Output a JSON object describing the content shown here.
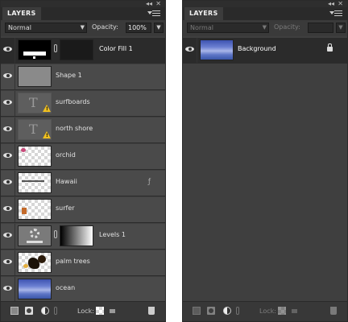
{
  "left_panel": {
    "tab_label": "LAYERS",
    "blend_mode": "Normal",
    "opacity_label": "Opacity:",
    "opacity_value": "100%",
    "layers": [
      {
        "name": "Color Fill 1",
        "thumb": "fill-thumb"
      },
      {
        "name": "Shape 1",
        "thumb": "shape-thumb"
      },
      {
        "name": "surfboards",
        "thumb": "text-thumb"
      },
      {
        "name": "north shore",
        "thumb": "text-thumb"
      },
      {
        "name": "orchid",
        "thumb": "transparent-thumb"
      },
      {
        "name": "Hawaii",
        "thumb": "transparent-thumb"
      },
      {
        "name": "surfer",
        "thumb": "transparent-thumb"
      },
      {
        "name": "Levels 1",
        "thumb": "adjustment-thumb"
      },
      {
        "name": "palm trees",
        "thumb": "photo-thumb"
      },
      {
        "name": "ocean",
        "thumb": "photo-thumb"
      }
    ],
    "lock_label": "Lock:"
  },
  "right_panel": {
    "tab_label": "LAYERS",
    "blend_mode": "Normal",
    "opacity_label": "Opacity:",
    "opacity_value": "",
    "layers": [
      {
        "name": "Background",
        "thumb": "photo-thumb"
      }
    ],
    "lock_label": "Lock:"
  },
  "icons": {
    "eye": "eye-icon",
    "warning": "warning-icon",
    "link": "link-icon",
    "lock": "lock-icon",
    "trash": "trash-icon",
    "panel_menu": "panel-menu-icon"
  },
  "colors": {
    "panel_bg": "#3f3f3f",
    "row_bg": "#4a4a4a",
    "selected_row_bg": "#2b2b2b",
    "warning": "#f0c020"
  }
}
